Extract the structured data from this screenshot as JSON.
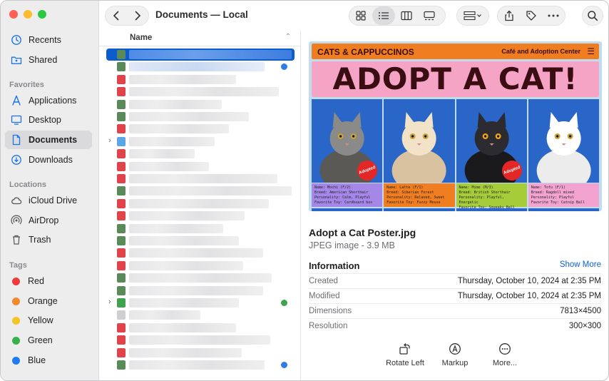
{
  "window": {
    "title": "Documents — Local"
  },
  "sidebar": {
    "favorites_header": "Favorites",
    "locations_header": "Locations",
    "tags_header": "Tags",
    "top_items": [
      {
        "label": "Recents",
        "icon": "clock-icon"
      },
      {
        "label": "Shared",
        "icon": "shared-folder-icon"
      }
    ],
    "favorites": [
      {
        "label": "Applications",
        "icon": "applications-icon"
      },
      {
        "label": "Desktop",
        "icon": "desktop-icon"
      },
      {
        "label": "Documents",
        "icon": "document-icon",
        "active": true
      },
      {
        "label": "Downloads",
        "icon": "download-icon"
      }
    ],
    "locations": [
      {
        "label": "iCloud Drive",
        "icon": "cloud-icon"
      },
      {
        "label": "AirDrop",
        "icon": "airdrop-icon"
      },
      {
        "label": "Trash",
        "icon": "trash-icon"
      }
    ],
    "tags": [
      {
        "label": "Red",
        "color": "#ef3b3b"
      },
      {
        "label": "Orange",
        "color": "#f28a2c"
      },
      {
        "label": "Yellow",
        "color": "#f5c523"
      },
      {
        "label": "Green",
        "color": "#37b34a"
      },
      {
        "label": "Blue",
        "color": "#1f7df2"
      }
    ]
  },
  "list": {
    "column_name": "Name",
    "sort_glyph": "⌃"
  },
  "preview": {
    "poster": {
      "brand": "CATS & CAPPUCCINOS",
      "subtitle": "Café and Adoption Center",
      "headline": "ADOPT A CAT!",
      "cats": [
        {
          "lines": [
            "Name: Mochi (F/2)",
            "Breed: American Shorthair",
            "Personality: Calm, Playful",
            "Favorite Toy: Cardboard box"
          ],
          "color": "#a587e8",
          "badge": "Adopted"
        },
        {
          "lines": [
            "Name: Latte (F/1)",
            "Breed: Siberian Forest",
            "Personality: Relaxed, Sweet",
            "Favorite Toy: Fuzzy Mouse"
          ],
          "color": "#f07d1f",
          "badge": ""
        },
        {
          "lines": [
            "Name: Mimo (M/3)",
            "Breed: British Shorthair",
            "Personality: Playful, Energetic",
            "Favorite Toy: Squeaky Ball"
          ],
          "color": "#a7cc3a",
          "badge": "Adopted"
        },
        {
          "lines": [
            "Name: Tofu (F/1)",
            "Breed: Ragdoll mixed",
            "Personality: Playful",
            "Favorite Toy: Catnip Ball"
          ],
          "color": "#f2a3cf",
          "badge": ""
        }
      ]
    },
    "file_name": "Adopt a Cat Poster.jpg",
    "file_type": "JPEG image - 3.9 MB",
    "info_title": "Information",
    "show_more": "Show More",
    "info": [
      {
        "key": "Created",
        "value": "Thursday, October 10, 2024 at 2:35 PM"
      },
      {
        "key": "Modified",
        "value": "Thursday, October 10, 2024 at 2:35 PM"
      },
      {
        "key": "Dimensions",
        "value": "7813×4500"
      },
      {
        "key": "Resolution",
        "value": "300×300"
      }
    ],
    "actions": [
      {
        "label": "Rotate Left",
        "icon": "rotate-left-icon"
      },
      {
        "label": "Markup",
        "icon": "markup-icon"
      },
      {
        "label": "More...",
        "icon": "more-icon"
      }
    ]
  },
  "toolbar": {
    "back_glyph": "‹",
    "forward_glyph": "›"
  }
}
